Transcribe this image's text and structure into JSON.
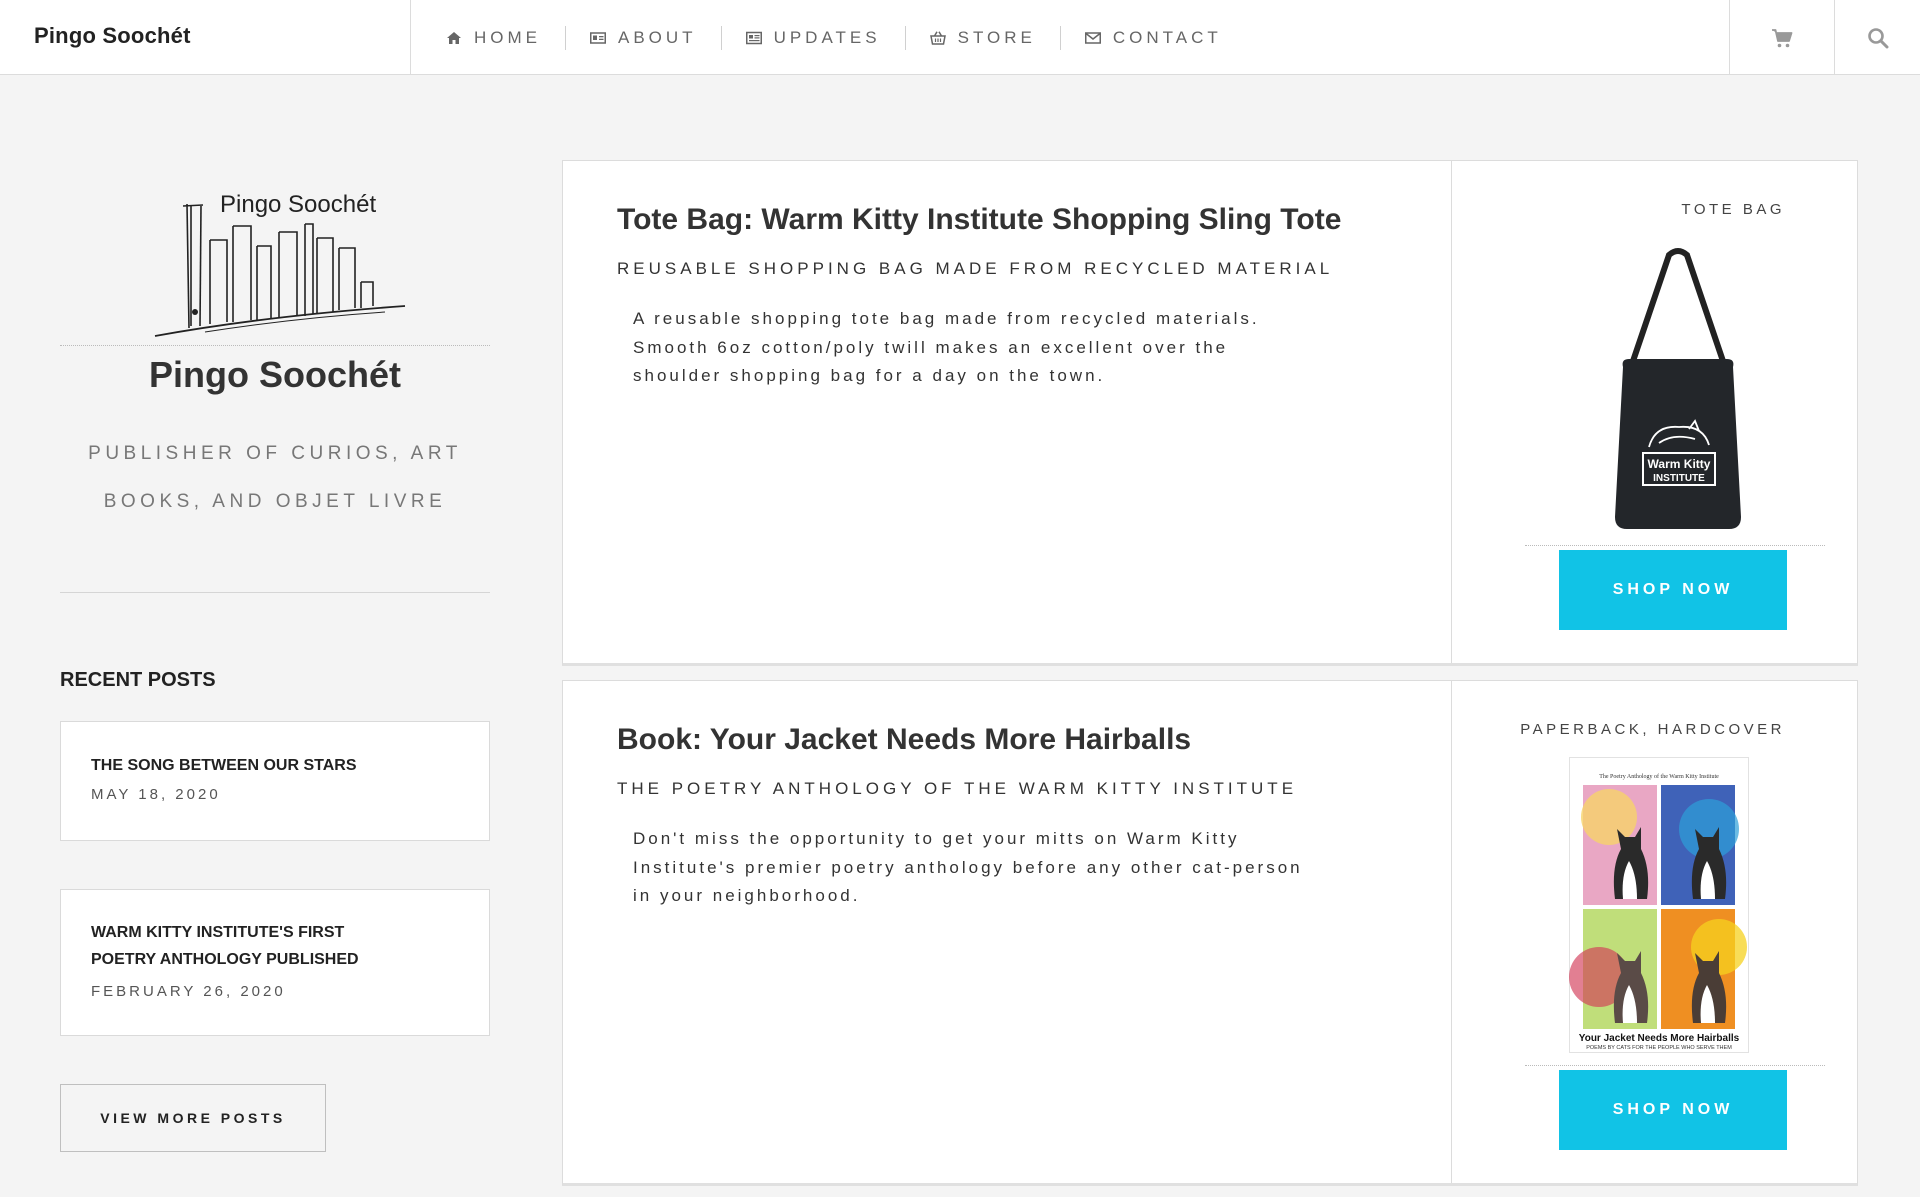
{
  "brand": {
    "name": "Pingo Soochét"
  },
  "nav": {
    "items": [
      {
        "label": "HOME",
        "icon": "home-icon"
      },
      {
        "label": "ABOUT",
        "icon": "id-card-icon"
      },
      {
        "label": "UPDATES",
        "icon": "newspaper-icon"
      },
      {
        "label": "STORE",
        "icon": "basket-icon"
      },
      {
        "label": "CONTACT",
        "icon": "envelope-icon"
      }
    ],
    "cart_icon": "cart-icon",
    "search_icon": "search-icon"
  },
  "sidebar": {
    "logo_text": "Pingo Soochét",
    "title": "Pingo Soochét",
    "tagline_line1": "PUBLISHER OF CURIOS, ART",
    "tagline_line2": "BOOKS, AND OBJET LIVRE",
    "recent_heading": "RECENT POSTS",
    "posts": [
      {
        "title_line1": "THE SONG BETWEEN OUR STARS",
        "title_line2": "",
        "date": "MAY 18, 2020"
      },
      {
        "title_line1": "WARM KITTY INSTITUTE'S FIRST",
        "title_line2": "POETRY ANTHOLOGY PUBLISHED",
        "date": "FEBRUARY 26, 2020"
      }
    ],
    "more_label": "VIEW MORE POSTS"
  },
  "products": [
    {
      "title": "Tote Bag: Warm Kitty Institute Shopping Sling Tote",
      "subtitle": "REUSABLE SHOPPING BAG MADE FROM RECYCLED MATERIAL",
      "desc_line1": "A reusable shopping tote bag made from recycled materials.",
      "desc_line2": "Smooth 6oz cotton/poly twill makes an excellent over the",
      "desc_line3": "shoulder shopping bag for a day on the town.",
      "tag": "TOTE BAG",
      "image_text_line1": "Warm Kitty",
      "image_text_line2": "INSTITUTE",
      "button": "SHOP NOW"
    },
    {
      "title": "Book: Your Jacket Needs More Hairballs",
      "subtitle": "THE POETRY ANTHOLOGY OF THE WARM KITTY INSTITUTE",
      "desc_line1": "Don't miss the opportunity to get your mitts on Warm Kitty",
      "desc_line2": "Institute's premier poetry anthology before any other cat-person",
      "desc_line3": "in your neighborhood.",
      "tag": "PAPERBACK, HARDCOVER",
      "cover_header": "The Poetry Anthology of the Warm Kitty Institute",
      "cover_title": "Your Jacket Needs More Hairballs",
      "cover_subtitle": "POEMS BY CATS FOR THE PEOPLE WHO SERVE THEM",
      "button": "SHOP NOW"
    }
  ],
  "colors": {
    "accent": "#11c3e6",
    "background": "#f4f4f4",
    "text": "#222222"
  }
}
